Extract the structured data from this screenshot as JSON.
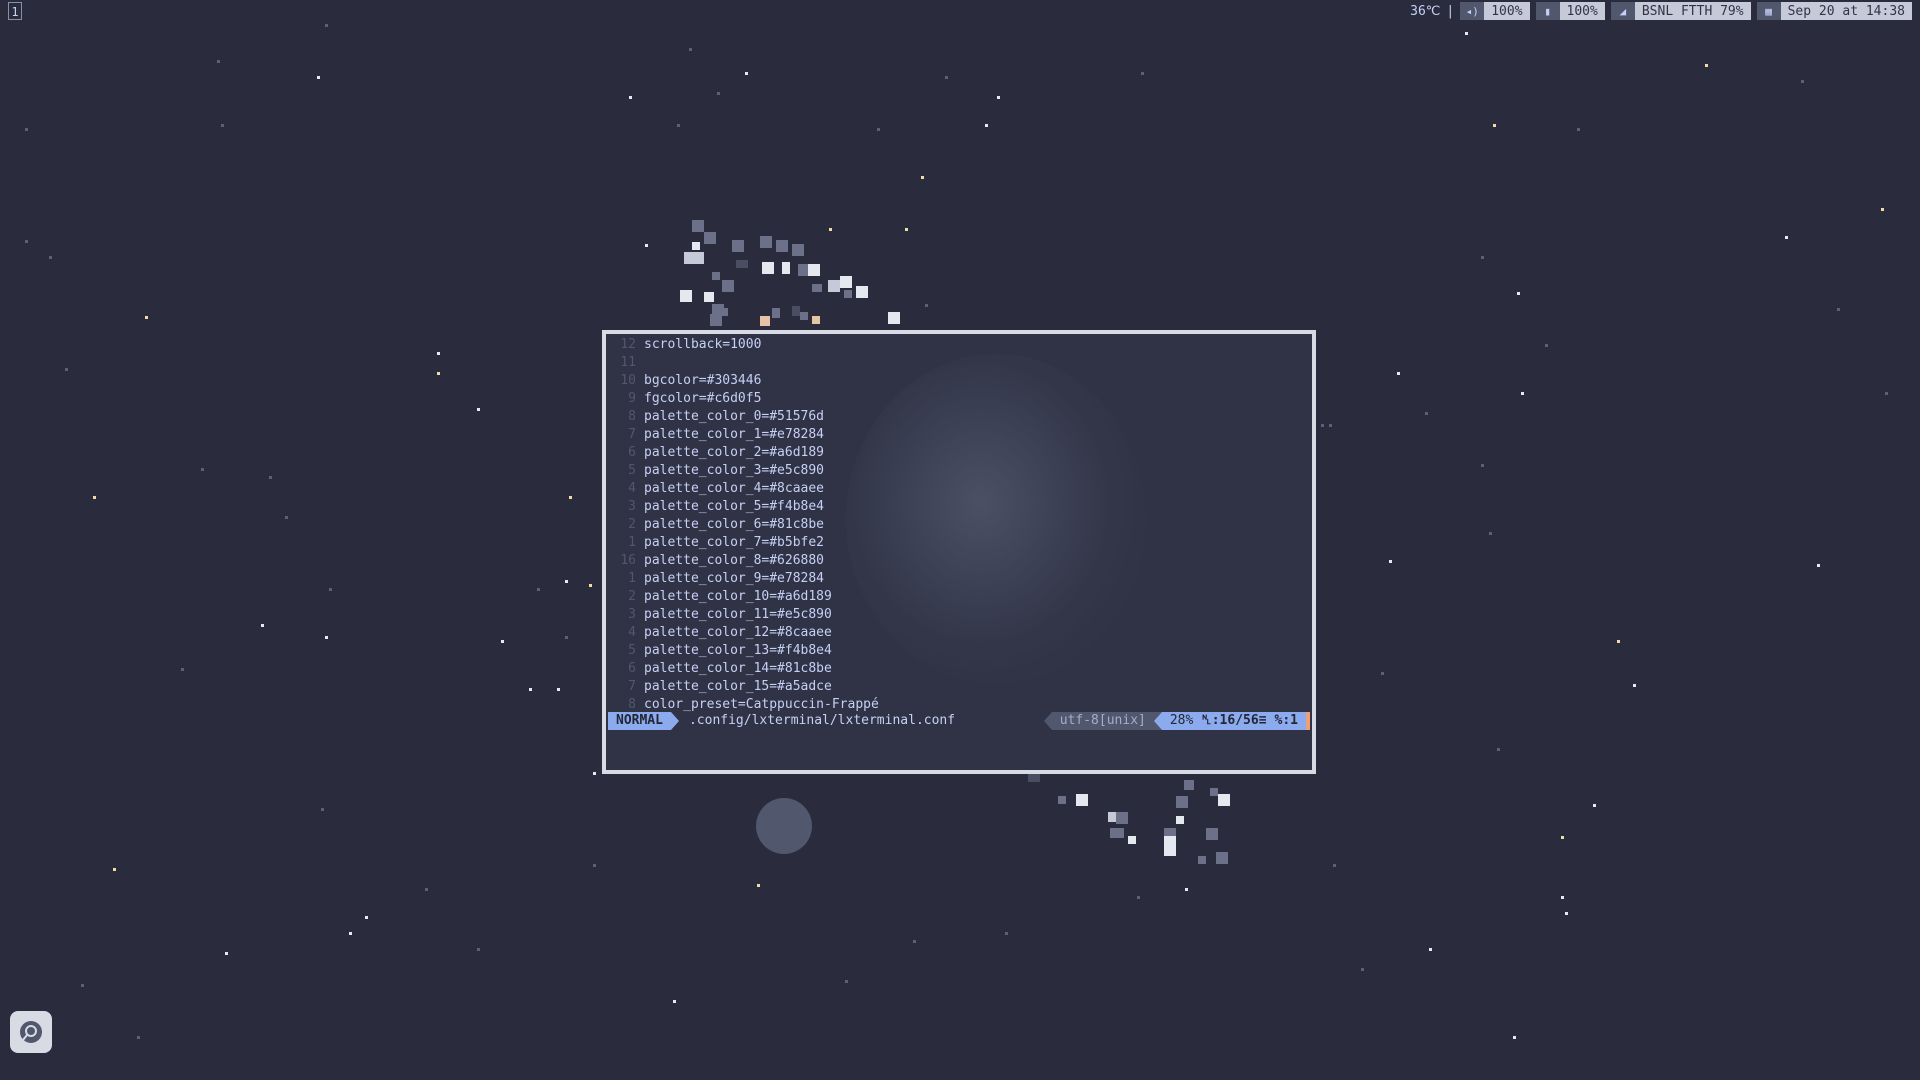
{
  "workspace": {
    "number": "1"
  },
  "statusbar": {
    "temperature": "36℃",
    "separator": "|",
    "volume": {
      "icon": "speaker-icon",
      "value": "100%"
    },
    "battery": {
      "icon": "battery-icon",
      "value": "100%"
    },
    "network": {
      "icon": "wifi-icon",
      "value": "BSNL FTTH 79%"
    },
    "clock": {
      "icon": "calendar-icon",
      "value": "Sep 20 at 14:38"
    }
  },
  "editor": {
    "lines": [
      {
        "num": "12",
        "text": "scrollback=1000"
      },
      {
        "num": "11",
        "text": ""
      },
      {
        "num": "10",
        "text": "bgcolor=#303446"
      },
      {
        "num": "9",
        "text": "fgcolor=#c6d0f5"
      },
      {
        "num": "8",
        "text": "palette_color_0=#51576d"
      },
      {
        "num": "7",
        "text": "palette_color_1=#e78284"
      },
      {
        "num": "6",
        "text": "palette_color_2=#a6d189"
      },
      {
        "num": "5",
        "text": "palette_color_3=#e5c890"
      },
      {
        "num": "4",
        "text": "palette_color_4=#8caaee"
      },
      {
        "num": "3",
        "text": "palette_color_5=#f4b8e4"
      },
      {
        "num": "2",
        "text": "palette_color_6=#81c8be"
      },
      {
        "num": "1",
        "text": "palette_color_7=#b5bfe2"
      },
      {
        "num": "16",
        "text": "palette_color_8=#626880"
      },
      {
        "num": "1",
        "text": "palette_color_9=#e78284"
      },
      {
        "num": "2",
        "text": "palette_color_10=#a6d189"
      },
      {
        "num": "3",
        "text": "palette_color_11=#e5c890"
      },
      {
        "num": "4",
        "text": "palette_color_12=#8caaee"
      },
      {
        "num": "5",
        "text": "palette_color_13=#f4b8e4"
      },
      {
        "num": "6",
        "text": "palette_color_14=#81c8be"
      },
      {
        "num": "7",
        "text": "palette_color_15=#a5adce"
      },
      {
        "num": "8",
        "text": "color_preset=Catppuccin-Frappé"
      }
    ],
    "status": {
      "mode": "NORMAL",
      "file": ".config/lxterminal/lxterminal.conf",
      "encoding": "utf-8[unix]",
      "percent": "28%",
      "position": "␤:16/56≡",
      "column": "%:1"
    }
  },
  "colors": {
    "background": "#2a2b3c",
    "terminal_bg": "#303446",
    "foreground": "#c6d0f5",
    "accent": "#8caaee"
  },
  "launcher": {
    "icon": "app-launcher-icon"
  }
}
